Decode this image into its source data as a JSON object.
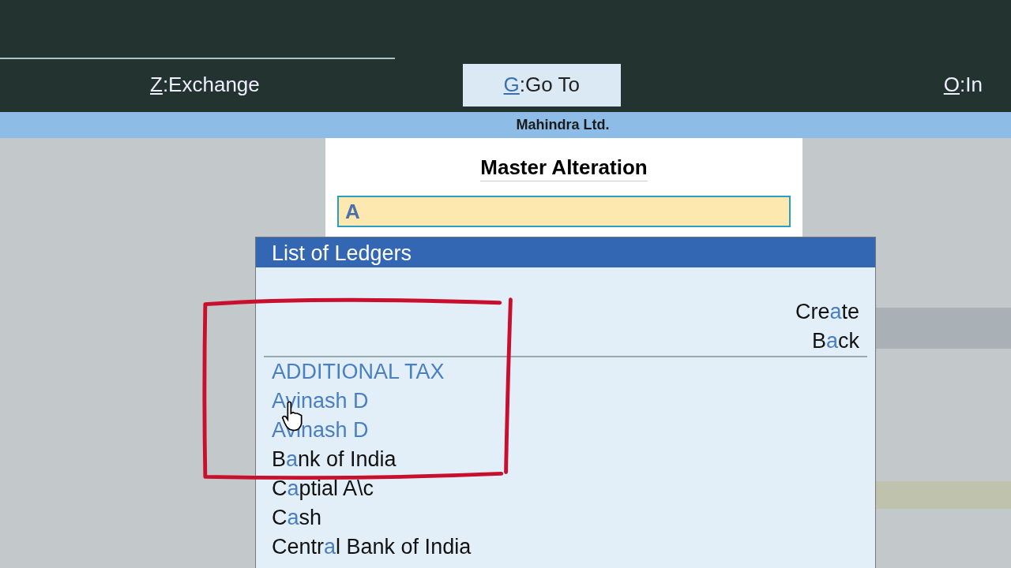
{
  "buttons": [
    {
      "key": "Z",
      "label": ":Exchange",
      "selected": false
    },
    {
      "key": "G",
      "label": ":Go To",
      "selected": true
    },
    {
      "key": "O",
      "label": ":In",
      "selected": false
    }
  ],
  "company": "Mahindra Ltd.",
  "master_alteration": {
    "title": "Master Alteration",
    "value": "A"
  },
  "list_of_ledgers": {
    "title": "List of Ledgers",
    "actions": [
      {
        "pre": "Cre",
        "hit": "a",
        "post": "te"
      },
      {
        "pre": "B",
        "hit": "a",
        "post": "ck"
      }
    ],
    "items": [
      {
        "kind": "full",
        "post": "ADDITIONAL TAX"
      },
      {
        "kind": "full",
        "post": "Avinash D"
      },
      {
        "kind": "full",
        "post": "Avinash D"
      },
      {
        "kind": "partial",
        "pre": "B",
        "hit": "a",
        "post": "nk of India"
      },
      {
        "kind": "partial",
        "pre": "C",
        "hit": "a",
        "post": "ptial A\\c"
      },
      {
        "kind": "partial",
        "pre": "C",
        "hit": "a",
        "post": "sh"
      },
      {
        "kind": "partial",
        "pre": "Centr",
        "hit": "a",
        "post": "l Bank of India"
      }
    ]
  }
}
